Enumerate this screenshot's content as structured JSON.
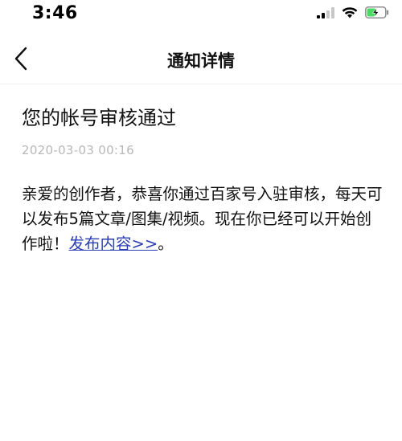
{
  "status_bar": {
    "time": "3:46",
    "icons": [
      "signal-icon",
      "wifi-icon",
      "battery-charging-icon"
    ]
  },
  "nav": {
    "back_icon": "chevron-left-icon",
    "title": "通知详情"
  },
  "notice": {
    "title": "您的帐号审核通过",
    "timestamp": "2020-03-03 00:16",
    "body_before_link": "亲爱的创作者，恭喜你通过百家号入驻审核，每天可以发布5篇文章/图集/视频。现在你已经可以开始创作啦！",
    "link_label": "发布内容>>",
    "body_after_link": "。"
  },
  "colors": {
    "link": "#2a3fb4",
    "timestamp": "#b8b8b8",
    "battery_fill": "#4cd964"
  }
}
